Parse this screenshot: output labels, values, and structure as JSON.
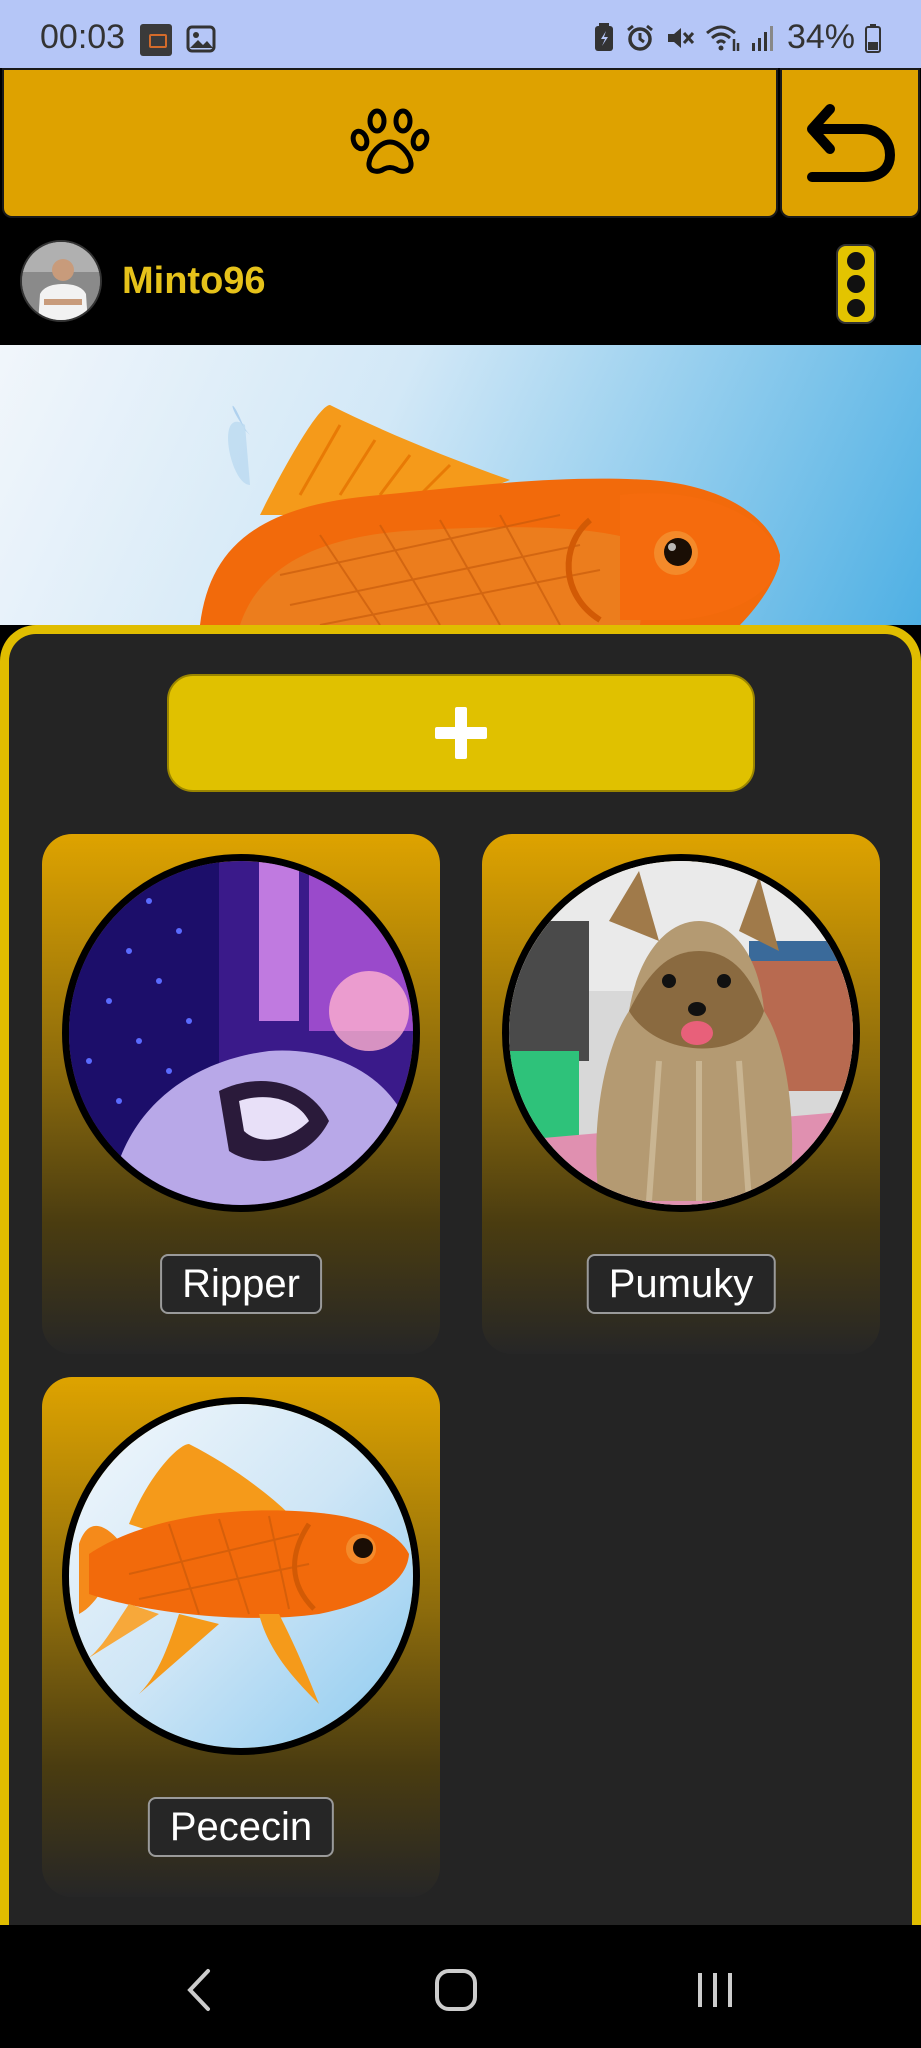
{
  "status_bar": {
    "time": "00:03",
    "battery": "34%"
  },
  "top_bar": {
    "center_icon": "paw-icon",
    "back_icon": "back-arrow-icon",
    "accent_color": "#dea200"
  },
  "user": {
    "username": "Minto96",
    "menu_icon": "three-dots-vertical-icon",
    "name_color": "#e6c21a"
  },
  "add_button": {
    "icon": "plus-icon",
    "color": "#e0c100"
  },
  "pets": [
    {
      "name": "Ripper"
    },
    {
      "name": "Pumuky"
    },
    {
      "name": "Pececin"
    }
  ],
  "nav": {
    "back_icon": "nav-back-icon",
    "home_icon": "nav-home-icon",
    "recents_icon": "nav-recents-icon"
  }
}
